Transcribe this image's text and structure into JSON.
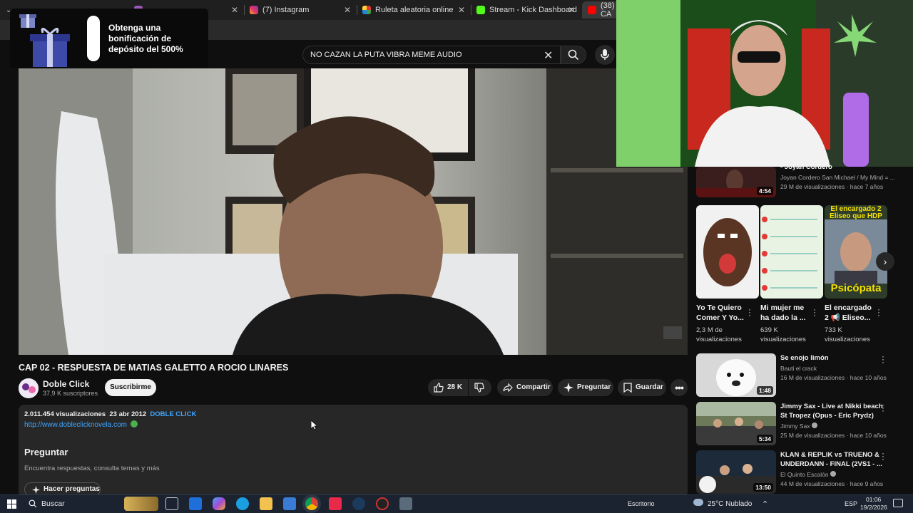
{
  "browser": {
    "tabs": [
      {
        "title": "",
        "color": "#9b59b6"
      },
      {
        "title": "(7) Instagram",
        "color": "#e1306c"
      },
      {
        "title": "Ruleta aleatoria online – ruleta",
        "color": "#4caf50"
      },
      {
        "title": "Stream - Kick Dashboard",
        "color": "#53fc18"
      },
      {
        "title": "(38) CA",
        "color": "#ff0000"
      }
    ]
  },
  "ad": {
    "text": "Obtenga una bonificación de depósito del 500%"
  },
  "search": {
    "query": "NO CAZAN LA PUTA VIBRA MEME AUDIO"
  },
  "video": {
    "title": "CAP 02 - RESPUESTA DE MATIAS GALETTO A ROCIO LINARES",
    "channel": "Doble Click",
    "subscribers": "37,9 K suscriptores",
    "subscribe_label": "Suscribirme",
    "likes": "28 K",
    "share_label": "Compartir",
    "ask_label": "Preguntar",
    "save_label": "Guardar"
  },
  "description": {
    "views": "2.011.454 visualizaciones",
    "date": "23 abr 2012",
    "tag": "DOBLE CLICK",
    "link": "http://www.dobleclicknovela.com",
    "ask_title": "Preguntar",
    "ask_subtitle": "Encuentra respuestas, consulta temas y más",
    "ask_button": "Hacer preguntas"
  },
  "sidebar": {
    "top_item": {
      "title_partial": "- Joyan Cordero",
      "channel": "Joyan Cordero San Michael / My Mind = ...",
      "meta": "29 M de visualizaciones · hace 7 años",
      "duration": "4:54"
    },
    "shorts": [
      {
        "title_line1": "Yo Te Quiero",
        "title_line2": "Comer Y Yo...",
        "views_line1": "2,3 M de",
        "views_line2": "visualizaciones"
      },
      {
        "title_line1": "Mi mujer me",
        "title_line2": "ha dado la ...",
        "views_line1": "639 K",
        "views_line2": "visualizaciones"
      },
      {
        "title_line1": "El encargado",
        "title_line2": "2 📢 Eliseo...",
        "views_line1": "733 K",
        "views_line2": "visualizaciones",
        "thumb_top": "El encargado 2",
        "thumb_top2": "Eliseo que HDP",
        "thumb_bottom": "Psicópata"
      }
    ],
    "videos": [
      {
        "title_line1": "Se enojo limón",
        "title_line2": "",
        "channel": "Bauti el crack",
        "meta": "16 M de visualizaciones · hace 10 años",
        "duration": "1:48"
      },
      {
        "title_line1": "Jimmy Sax - Live at Nikki beach",
        "title_line2": "St Tropez (Opus - Eric Prydz)",
        "channel": "Jimmy Sax",
        "meta": "25 M de visualizaciones · hace 10 años",
        "duration": "5:34"
      },
      {
        "title_line1": "KLAN & REPLIK vs TRUENO &",
        "title_line2": "UNDERDANN - FINAL (2VS1 - ...",
        "channel": "El Quinto Escalón",
        "meta": "44 M de visualizaciones · hace 9 años",
        "duration": "13:50"
      }
    ]
  },
  "taskbar": {
    "search_label": "Buscar",
    "desktop_label": "Escritorio",
    "weather": "25°C  Nublado",
    "language": "ESP",
    "time": "01:06",
    "date": "19/2/2026"
  }
}
